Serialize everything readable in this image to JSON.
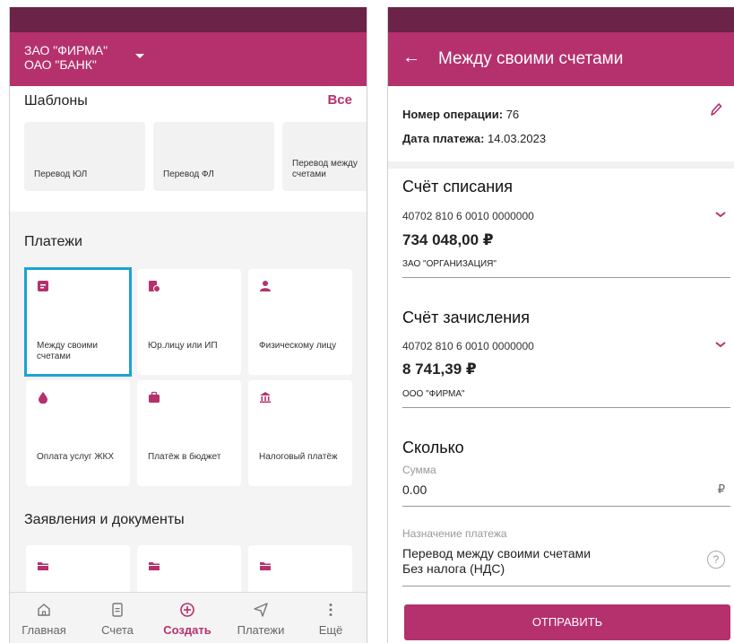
{
  "colors": {
    "status_bar": "#6b2347",
    "brand": "#b5316d",
    "selection": "#1ba3d8"
  },
  "left": {
    "org_line1": "ЗАО \"ФИРМА\"",
    "org_line2": "ОАО \"БАНК\"",
    "templates": {
      "title": "Шаблоны",
      "all_label": "Все",
      "items": [
        {
          "label": "Перевод ЮЛ"
        },
        {
          "label": "Перевод ФЛ"
        },
        {
          "label": "Перевод между счетами"
        }
      ]
    },
    "payments": {
      "title": "Платежи",
      "items": [
        {
          "label": "Между своими счетами",
          "icon": "document-icon",
          "selected": true
        },
        {
          "label": "Юр.лицу или ИП",
          "icon": "business-doc-icon"
        },
        {
          "label": "Физическому лицу",
          "icon": "person-icon"
        },
        {
          "label": "Оплата услуг ЖКХ",
          "icon": "drop-icon"
        },
        {
          "label": "Платёж в бюджет",
          "icon": "briefcase-icon"
        },
        {
          "label": "Налоговый платёж",
          "icon": "bank-icon"
        }
      ]
    },
    "documents": {
      "title": "Заявления и документы"
    },
    "nav": [
      {
        "label": "Главная",
        "icon": "home-icon"
      },
      {
        "label": "Счета",
        "icon": "accounts-icon"
      },
      {
        "label": "Создать",
        "icon": "plus-circle-icon",
        "active": true
      },
      {
        "label": "Платежи",
        "icon": "send-icon"
      },
      {
        "label": "Ещё",
        "icon": "more-vertical-icon"
      }
    ]
  },
  "right": {
    "title": "Между своими счетами",
    "op_label": "Номер операции:",
    "op_value": "76",
    "date_label": "Дата платежа:",
    "date_value": "14.03.2023",
    "debit": {
      "title": "Счёт списания",
      "account": "40702 810 6 0010 0000000",
      "amount": "734 048,00 ₽",
      "org": "ЗАО \"ОРГАНИЗАЦИЯ\""
    },
    "credit": {
      "title": "Счёт зачисления",
      "account": "40702 810 6 0010 0000000",
      "amount": "8 741,39 ₽",
      "org": "ООО \"ФИРМА\""
    },
    "how_much": {
      "title": "Сколько",
      "sum_label": "Сумма",
      "sum_value": "0.00",
      "currency": "₽"
    },
    "purpose": {
      "label": "Назначение платежа",
      "line1": "Перевод между своими счетами",
      "line2": "Без налога (НДС)"
    },
    "send_label": "ОТПРАВИТЬ"
  }
}
